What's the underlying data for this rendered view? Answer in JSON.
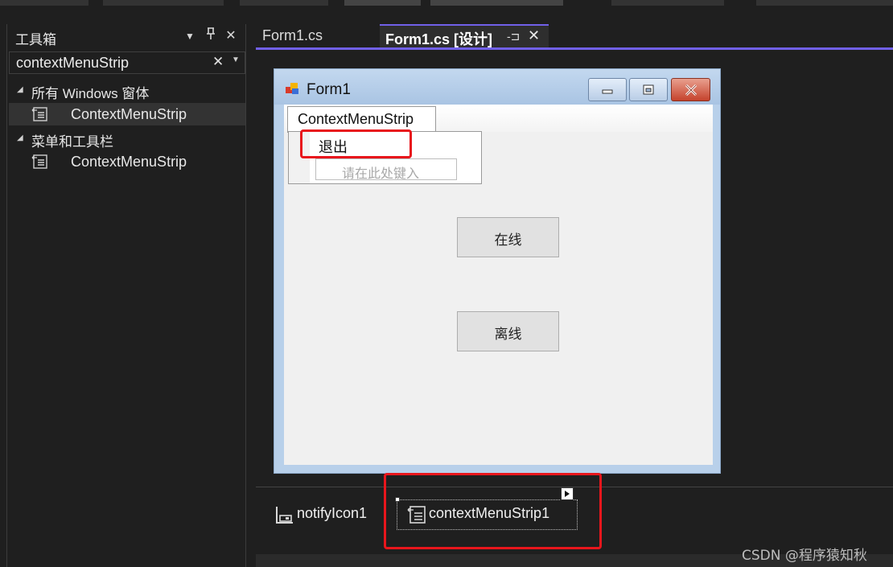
{
  "toolbox": {
    "title": "工具箱",
    "search_value": "contextMenuStrip",
    "categories": [
      {
        "label": "所有 Windows 窗体",
        "items": [
          {
            "label": "ContextMenuStrip"
          }
        ]
      },
      {
        "label": "菜单和工具栏",
        "items": [
          {
            "label": "ContextMenuStrip"
          }
        ]
      }
    ]
  },
  "tabs": [
    {
      "label": "Form1.cs"
    },
    {
      "label": "Form1.cs [设计]"
    }
  ],
  "form": {
    "title": "Form1",
    "menu_label": "ContextMenuStrip",
    "menu_item_exit": "退出",
    "type_here_placeholder": "请在此处键入",
    "online_button": "在线",
    "offline_button": "离线"
  },
  "tray": {
    "notify_icon": "notifyIcon1",
    "context_menu": "contextMenuStrip1"
  },
  "watermark": "CSDN @程序猿知秋",
  "icons": {
    "toolbox_item": "context-menu-strip-icon",
    "notify": "notify-icon-icon"
  },
  "colors": {
    "accent": "#7160e8",
    "highlight_red": "#e8161c",
    "form_caption": "#b8d0ea"
  }
}
